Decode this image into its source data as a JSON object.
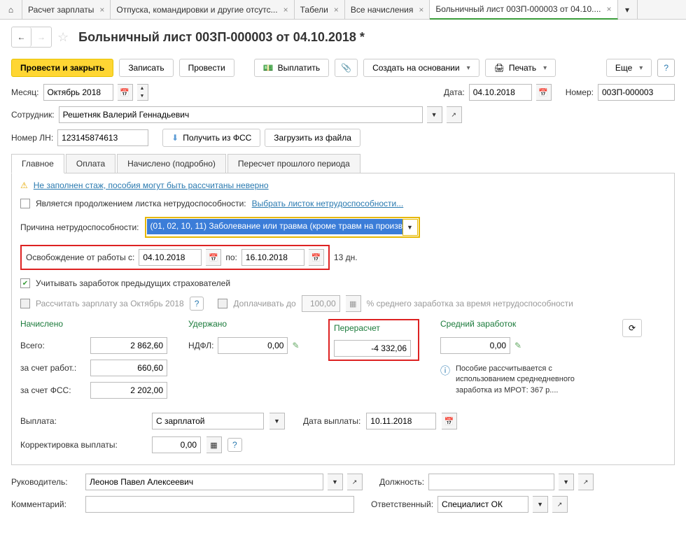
{
  "tabs": {
    "salary": "Расчет зарплаты",
    "absence": "Отпуска, командировки и другие отсутс...",
    "timesheet": "Табели",
    "accruals": "Все начисления",
    "sickleave": "Больничный лист 00ЗП-000003 от 04.10...."
  },
  "title": "Больничный лист 00ЗП-000003 от 04.10.2018 *",
  "cmd": {
    "post_close": "Провести и закрыть",
    "write": "Записать",
    "post": "Провести",
    "pay": "Выплатить",
    "create_based": "Создать на основании",
    "print": "Печать",
    "more": "Еще"
  },
  "fields": {
    "month_label": "Месяц:",
    "month": "Октябрь 2018",
    "date_label": "Дата:",
    "date": "04.10.2018",
    "number_label": "Номер:",
    "number": "00ЗП-000003",
    "employee_label": "Сотрудник:",
    "employee": "Решетняк Валерий Геннадьевич",
    "ln_label": "Номер ЛН:",
    "ln": "123145874613",
    "get_fss": "Получить из ФСС",
    "load_file": "Загрузить из файла"
  },
  "formtabs": {
    "main": "Главное",
    "payment": "Оплата",
    "accrued": "Начислено (подробно)",
    "recalc": "Пересчет прошлого периода"
  },
  "main": {
    "warning": "Не заполнен стаж, пособия могут быть рассчитаны неверно",
    "continuation_label": "Является продолжением листка нетрудоспособности:",
    "continuation_link": "Выбрать листок нетрудоспособности...",
    "reason_label": "Причина нетрудоспособности:",
    "reason_value": "(01, 02, 10, 11) Заболевание или травма (кроме травм на произв",
    "release_label": "Освобождение от работы с:",
    "date_from": "04.10.2018",
    "to_label": "по:",
    "date_to": "16.10.2018",
    "days": "13 дн.",
    "prev_insurers": "Учитывать заработок предыдущих страхователей",
    "calc_salary": "Рассчитать зарплату за Октябрь 2018",
    "topup_label": "Доплачивать до",
    "topup_value": "100,00",
    "topup_suffix": "% среднего заработка за время нетрудоспособности"
  },
  "totals": {
    "accrued_head": "Начислено",
    "total_label": "Всего:",
    "total": "2 862,60",
    "employer_label": "за счет работ.:",
    "employer": "660,60",
    "fss_label": "за счет ФСС:",
    "fss": "2 202,00",
    "withheld_head": "Удержано",
    "ndfl_label": "НДФЛ:",
    "ndfl": "0,00",
    "recalc_head": "Перерасчет",
    "recalc": "-4 332,06",
    "avg_head": "Средний заработок",
    "avg": "0,00",
    "info": "Пособие рассчитывается с использованием среднедневного заработка из МРОТ: 367 р...."
  },
  "payout": {
    "label": "Выплата:",
    "mode": "С зарплатой",
    "paydate_label": "Дата выплаты:",
    "paydate": "10.11.2018",
    "correction_label": "Корректировка выплаты:",
    "correction": "0,00"
  },
  "footer": {
    "manager_label": "Руководитель:",
    "manager": "Леонов Павел Алексеевич",
    "position_label": "Должность:",
    "position": "",
    "comment_label": "Комментарий:",
    "comment": "",
    "responsible_label": "Ответственный:",
    "responsible": "Специалист ОК"
  }
}
